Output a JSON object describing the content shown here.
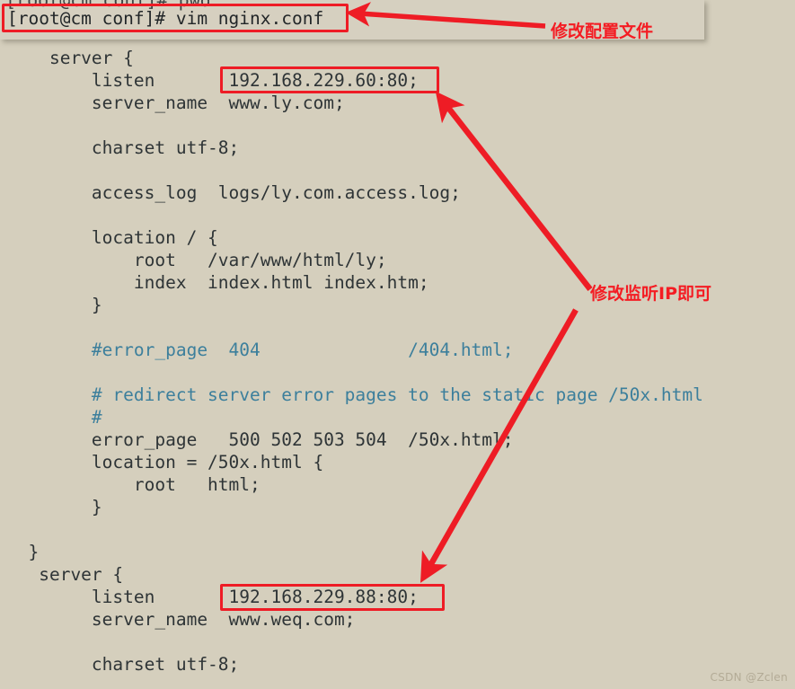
{
  "colors": {
    "background": "#d5cfbd",
    "terminal_background": "#d6d0c0",
    "text": "#2e3436",
    "comment": "#3c7f9c",
    "annotation_red": "#ee1c25",
    "label_red": "#f41c23",
    "watermark": "#b3ab96"
  },
  "terminal": {
    "partial_line_above": "[root@cm conf]# pwd",
    "prompt_line": "[root@cm conf]# vim nginx.conf"
  },
  "code": {
    "lines": [
      {
        "text": "    server {",
        "style": "normal"
      },
      {
        "text": "        listen       192.168.229.60:80;",
        "style": "normal"
      },
      {
        "text": "        server_name  www.ly.com;",
        "style": "normal"
      },
      {
        "text": "",
        "style": "normal"
      },
      {
        "text": "        charset utf-8;",
        "style": "normal"
      },
      {
        "text": "",
        "style": "normal"
      },
      {
        "text": "        access_log  logs/ly.com.access.log;",
        "style": "normal"
      },
      {
        "text": "",
        "style": "normal"
      },
      {
        "text": "        location / {",
        "style": "normal"
      },
      {
        "text": "            root   /var/www/html/ly;",
        "style": "normal"
      },
      {
        "text": "            index  index.html index.htm;",
        "style": "normal"
      },
      {
        "text": "        }",
        "style": "normal"
      },
      {
        "text": "",
        "style": "normal"
      },
      {
        "text": "        #error_page  404              /404.html;",
        "style": "comment"
      },
      {
        "text": "",
        "style": "normal"
      },
      {
        "text": "        # redirect server error pages to the static page /50x.html",
        "style": "comment"
      },
      {
        "text": "        #",
        "style": "comment"
      },
      {
        "text": "        error_page   500 502 503 504  /50x.html;",
        "style": "normal"
      },
      {
        "text": "        location = /50x.html {",
        "style": "normal"
      },
      {
        "text": "            root   html;",
        "style": "normal"
      },
      {
        "text": "        }",
        "style": "normal"
      },
      {
        "text": "",
        "style": "normal"
      },
      {
        "text": "  }",
        "style": "normal"
      },
      {
        "text": "   server {",
        "style": "normal"
      },
      {
        "text": "        listen       192.168.229.88:80;",
        "style": "normal"
      },
      {
        "text": "        server_name  www.weq.com;",
        "style": "normal"
      },
      {
        "text": "",
        "style": "normal"
      },
      {
        "text": "        charset utf-8;",
        "style": "normal"
      }
    ]
  },
  "annotations": {
    "edit_config_label": "修改配置文件",
    "change_ip_label": "修改监听IP即可",
    "highlight_values": {
      "listen_1": "192.168.229.60:80;",
      "listen_2": "192.168.229.88:80;",
      "prompt_command": "vim nginx.conf"
    }
  },
  "watermark": {
    "text": "CSDN @Zclen"
  }
}
